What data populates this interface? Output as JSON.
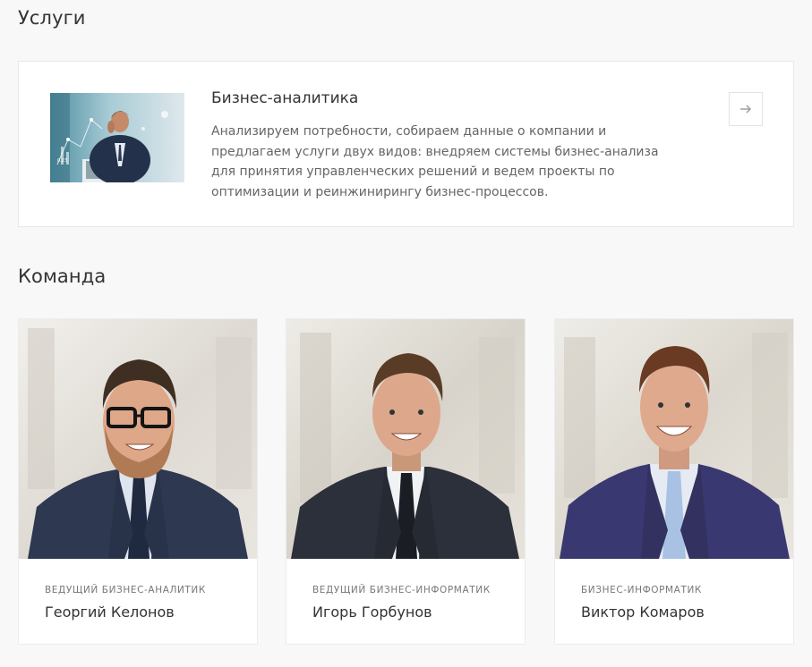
{
  "services": {
    "title": "Услуги",
    "items": [
      {
        "name": "Бизнес-аналитика",
        "description": "Анализируем потребности, собираем данные о компании и предлагаем услуги двух видов: внедряем системы бизнес-анализа для принятия управленческих решений и ведем проекты по оптимизации и реинжинирингу бизнес-процессов.",
        "arrow_icon": "arrow-right-icon"
      }
    ]
  },
  "team": {
    "title": "Команда",
    "members": [
      {
        "role": "Ведущий бизнес-аналитик",
        "name": "Георгий Келонов"
      },
      {
        "role": "Ведущий бизнес-информатик",
        "name": "Игорь Горбунов"
      },
      {
        "role": "Бизнес-информатик",
        "name": "Виктор Комаров"
      }
    ]
  },
  "colors": {
    "page_background": "#f8f8f8",
    "card_background": "#ffffff",
    "border": "#e8e8e8",
    "heading_text": "#333333",
    "body_text": "#666666"
  }
}
